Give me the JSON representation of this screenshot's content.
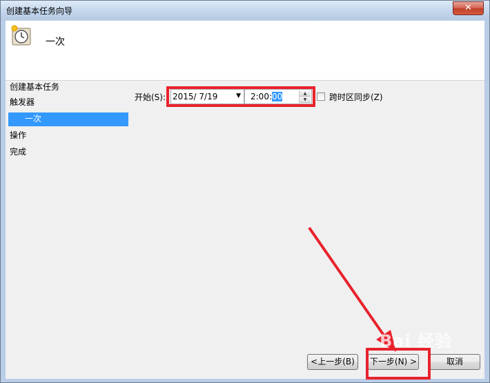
{
  "window": {
    "title": "创建基本任务向导",
    "close_glyph": "✕"
  },
  "header": {
    "title": "一次"
  },
  "nav": {
    "items": [
      {
        "label": "创建基本任务"
      },
      {
        "label": "触发器"
      },
      {
        "label": "一次"
      },
      {
        "label": "操作"
      },
      {
        "label": "完成"
      }
    ],
    "selected_index": 2
  },
  "form": {
    "start_label": "开始(S):",
    "date_value": "2015/  7/19",
    "time_value_prefix": "2:00:",
    "time_value_selected": "00",
    "timezone_sync_label": "跨时区同步(Z)",
    "timezone_sync_checked": false
  },
  "buttons": {
    "back_label": "<上一步(B)",
    "next_label": "下一步(N) >",
    "cancel_label": "取消"
  },
  "watermark": "Bai 经验",
  "colors": {
    "highlight_red": "#e8222d",
    "selection_blue": "#3399ff"
  }
}
